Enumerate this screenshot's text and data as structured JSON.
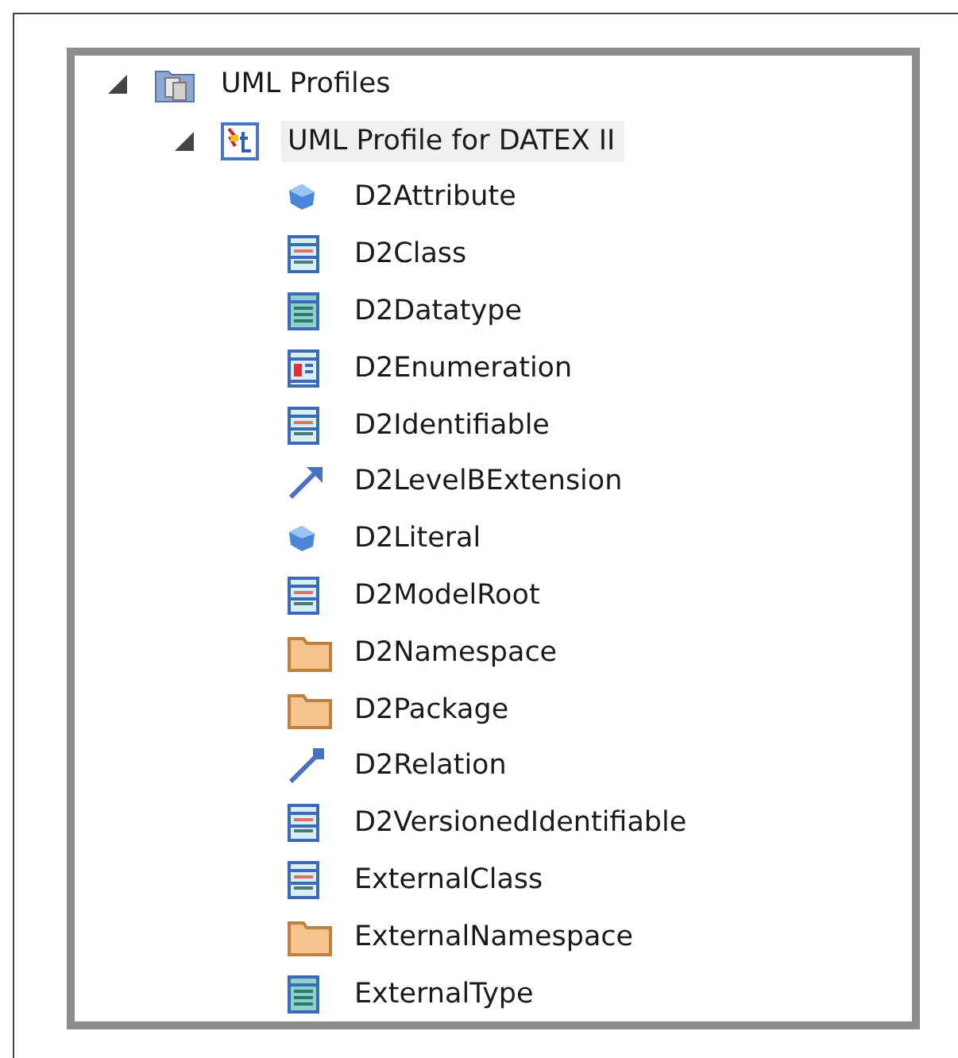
{
  "tree": [
    {
      "label": "UML Profiles",
      "kind": "profiles",
      "expanded": true,
      "selected": false,
      "children": [
        {
          "label": "UML Profile for DATEX II",
          "kind": "profile",
          "expanded": true,
          "selected": true,
          "children": [
            {
              "label": "D2Attribute",
              "kind": "attribute",
              "selected": false
            },
            {
              "label": "D2Class",
              "kind": "class",
              "selected": false
            },
            {
              "label": "D2Datatype",
              "kind": "datatype",
              "selected": false
            },
            {
              "label": "D2Enumeration",
              "kind": "enumeration",
              "selected": false
            },
            {
              "label": "D2Identifiable",
              "kind": "class",
              "selected": false
            },
            {
              "label": "D2LevelBExtension",
              "kind": "extension",
              "selected": false
            },
            {
              "label": "D2Literal",
              "kind": "attribute",
              "selected": false
            },
            {
              "label": "D2ModelRoot",
              "kind": "class",
              "selected": false
            },
            {
              "label": "D2Namespace",
              "kind": "folder",
              "selected": false
            },
            {
              "label": "D2Package",
              "kind": "folder",
              "selected": false
            },
            {
              "label": "D2Relation",
              "kind": "relation",
              "selected": false
            },
            {
              "label": "D2VersionedIdentifiable",
              "kind": "class",
              "selected": false
            },
            {
              "label": "ExternalClass",
              "kind": "class",
              "selected": false
            },
            {
              "label": "ExternalNamespace",
              "kind": "folder",
              "selected": false
            },
            {
              "label": "ExternalType",
              "kind": "datatype",
              "selected": false
            }
          ]
        }
      ]
    }
  ]
}
